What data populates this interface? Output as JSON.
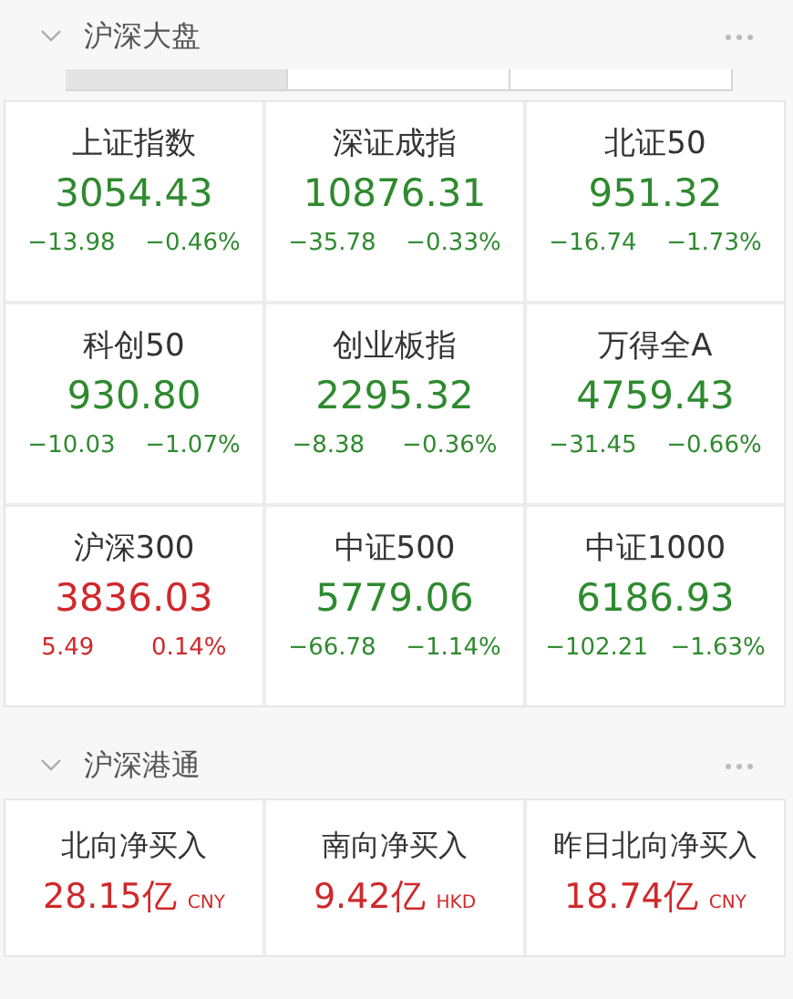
{
  "sections": [
    {
      "title": "沪深大盘",
      "expanded": true,
      "tabs": [
        {
          "selected": true
        },
        {
          "selected": false
        },
        {
          "selected": false
        }
      ],
      "indices": [
        {
          "name": "上证指数",
          "value": "3054.43",
          "change": "−13.98",
          "percent": "−0.46%",
          "color": "#2f8a2f"
        },
        {
          "name": "深证成指",
          "value": "10876.31",
          "change": "−35.78",
          "percent": "−0.33%",
          "color": "#2f8a2f"
        },
        {
          "name": "北证50",
          "value": "951.32",
          "change": "−16.74",
          "percent": "−1.73%",
          "color": "#2f8a2f"
        },
        {
          "name": "科创50",
          "value": "930.80",
          "change": "−10.03",
          "percent": "−1.07%",
          "color": "#2f8a2f"
        },
        {
          "name": "创业板指",
          "value": "2295.32",
          "change": "−8.38",
          "percent": "−0.36%",
          "color": "#2f8a2f"
        },
        {
          "name": "万得全A",
          "value": "4759.43",
          "change": "−31.45",
          "percent": "−0.66%",
          "color": "#2f8a2f"
        },
        {
          "name": "沪深300",
          "value": "3836.03",
          "change": "5.49",
          "percent": "0.14%",
          "color": "#d0282b"
        },
        {
          "name": "中证500",
          "value": "5779.06",
          "change": "−66.78",
          "percent": "−1.14%",
          "color": "#2f8a2f"
        },
        {
          "name": "中证1000",
          "value": "6186.93",
          "change": "−102.21",
          "percent": "−1.63%",
          "color": "#2f8a2f"
        }
      ]
    },
    {
      "title": "沪深港通",
      "expanded": true,
      "flows": [
        {
          "name": "北向净买入",
          "amount": "28.15亿",
          "currency": "CNY",
          "color": "#d0282b"
        },
        {
          "name": "南向净买入",
          "amount": "9.42亿",
          "currency": "HKD",
          "color": "#d0282b"
        },
        {
          "name": "昨日北向净买入",
          "amount": "18.74亿",
          "currency": "CNY",
          "color": "#d0282b"
        }
      ]
    }
  ]
}
